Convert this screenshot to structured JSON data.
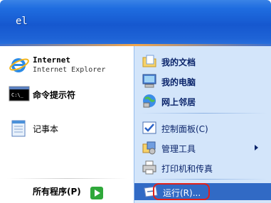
{
  "header": {
    "user_name": "el"
  },
  "left_pane": {
    "pinned": [
      {
        "title": "Internet",
        "subtitle": "Internet Explorer",
        "icon": "internet-explorer-icon"
      }
    ],
    "recent": [
      {
        "label": "命令提示符",
        "icon": "command-prompt-icon"
      },
      {
        "label": "记事本",
        "icon": "notepad-icon"
      }
    ],
    "all_programs": "所有程序(P)"
  },
  "right_pane": {
    "items": [
      {
        "label": "我的文档",
        "icon": "my-documents-icon"
      },
      {
        "label": "我的电脑",
        "icon": "my-computer-icon"
      },
      {
        "label": "网上邻居",
        "icon": "network-places-icon"
      },
      {
        "label": "控制面板(C)",
        "icon": "control-panel-icon"
      },
      {
        "label": "管理工具",
        "icon": "admin-tools-icon",
        "has_submenu": true
      },
      {
        "label": "打印机和传真",
        "icon": "printer-icon"
      }
    ],
    "run": {
      "label": "运行(R)...",
      "icon": "run-icon",
      "highlighted": true
    }
  },
  "colors": {
    "header_blue": "#1658cf",
    "right_pane_bg": "#d3e5fa",
    "selection_blue": "#316ac5",
    "highlight_red": "#e0201a",
    "all_programs_green": "#2fa83a"
  }
}
